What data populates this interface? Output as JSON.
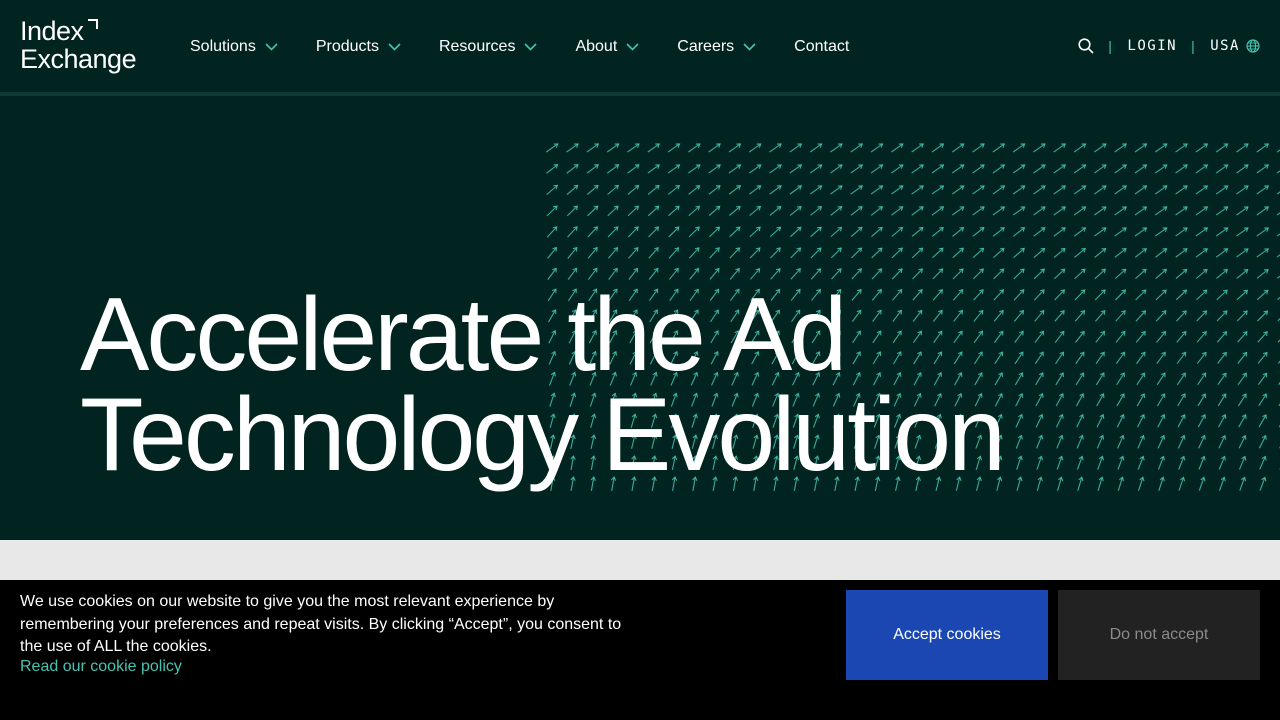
{
  "brand": {
    "logo_line1": "Index",
    "logo_line2": "Exchange"
  },
  "nav": {
    "items": [
      {
        "label": "Solutions",
        "dropdown": true
      },
      {
        "label": "Products",
        "dropdown": true
      },
      {
        "label": "Resources",
        "dropdown": true
      },
      {
        "label": "About",
        "dropdown": true
      },
      {
        "label": "Careers",
        "dropdown": true
      },
      {
        "label": "Contact",
        "dropdown": false
      }
    ]
  },
  "utility": {
    "search_icon": "search-icon",
    "separator": "|",
    "login_label": "LOGIN",
    "region_label": "USA",
    "region_icon": "globe-icon"
  },
  "hero": {
    "headline_line1": "Accelerate the Ad",
    "headline_line2": "Technology Evolution",
    "pattern_icon": "arrow-up-right-icon"
  },
  "cookie_banner": {
    "message": "We use cookies on our website to give you the most relevant experience by remembering your preferences and repeat visits. By clicking “Accept”, you consent to the use of ALL the cookies.",
    "policy_link": "Read our cookie policy",
    "accept_label": "Accept cookies",
    "decline_label": "Do not accept"
  },
  "colors": {
    "background": "#012420",
    "accent": "#48c3b0",
    "accept_button": "#1a47b1",
    "decline_button": "#222222",
    "cookie_bg": "#000000"
  }
}
